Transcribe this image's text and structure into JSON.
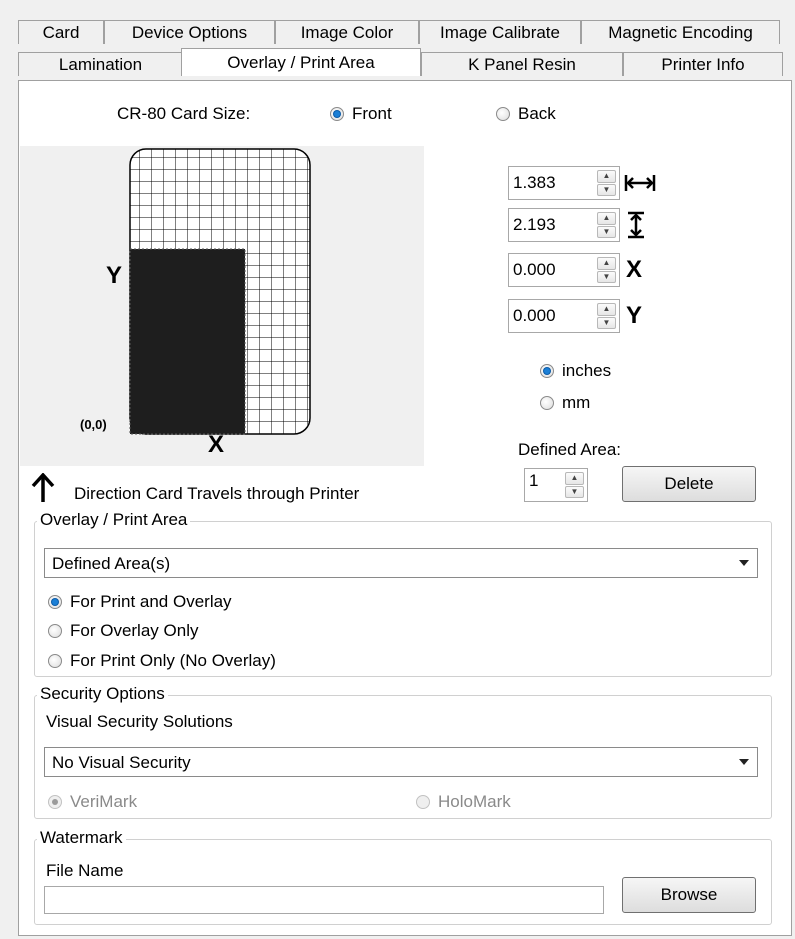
{
  "tabs_row1": [
    "Card",
    "Device Options",
    "Image Color",
    "Image Calibrate",
    "Magnetic Encoding"
  ],
  "tabs_row2": [
    "Lamination",
    "Overlay / Print Area",
    "K Panel Resin",
    "Printer Info"
  ],
  "active_tab": "Overlay / Print Area",
  "card_size": {
    "label": "CR-80 Card Size:",
    "front_label": "Front",
    "back_label": "Back",
    "selected": "Front"
  },
  "diagram": {
    "y_label": "Y",
    "x_label": "X",
    "origin_label": "(0,0)",
    "direction_text": "Direction Card Travels through Printer"
  },
  "dimensions": {
    "width_value": "1.383",
    "height_value": "2.193",
    "x_value": "0.000",
    "y_value": "0.000",
    "x_symbol": "X",
    "y_symbol": "Y"
  },
  "units": {
    "inches_label": "inches",
    "mm_label": "mm",
    "selected": "inches"
  },
  "defined_area": {
    "label": "Defined Area:",
    "value": "1",
    "delete_label": "Delete"
  },
  "overlay_group": {
    "title": "Overlay / Print Area",
    "dropdown_value": "Defined Area(s)",
    "options": [
      "For Print and Overlay",
      "For Overlay Only",
      "For Print Only (No Overlay)"
    ],
    "selected_index": 0
  },
  "security_group": {
    "title": "Security Options",
    "subtitle": "Visual Security Solutions",
    "dropdown_value": "No Visual Security",
    "verimark_label": "VeriMark",
    "holomark_label": "HoloMark"
  },
  "watermark_group": {
    "title": "Watermark",
    "file_name_label": "File Name",
    "file_name_value": "",
    "browse_label": "Browse"
  }
}
